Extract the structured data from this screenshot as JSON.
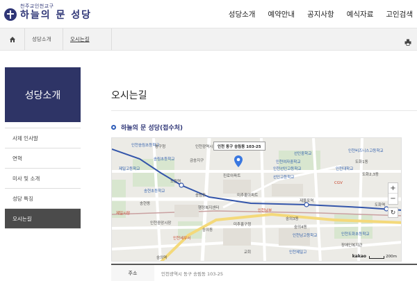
{
  "header": {
    "logo_sub": "천주교인천교구",
    "logo_main": "하늘의 문 성당",
    "nav": [
      "성당소개",
      "예약안내",
      "공지사항",
      "예식자료",
      "고인검색"
    ]
  },
  "breadcrumb": {
    "home_icon": "home-icon",
    "items": [
      "성당소개",
      "오시는길"
    ],
    "print_icon": "printer-icon"
  },
  "sidebar": {
    "title": "성당소개",
    "items": [
      {
        "label": "사제 인사말",
        "active": false
      },
      {
        "label": "연혁",
        "active": false
      },
      {
        "label": "미사 및 소개",
        "active": false
      },
      {
        "label": "성당 특징",
        "active": false
      },
      {
        "label": "오시는길",
        "active": true
      }
    ]
  },
  "main": {
    "title": "오시는길",
    "section_title": "하늘의 문 성당(접수처)",
    "map": {
      "tooltip": "인천 동구 송림동 103-25",
      "zoom_in": "+",
      "zoom_out": "−",
      "reset": "↻",
      "logo": "kakao",
      "scale": "200m",
      "labels": {
        "l1": "인천송림초등학교",
        "l2": "금송지구",
        "l3": "진로아파트",
        "l4": "송림동",
        "l5": "인천여자중학교",
        "l6": "선인고등학교",
        "l7": "도원역",
        "l8": "송현동",
        "l9": "행정복지센터",
        "l10": "미추홀구청",
        "l11": "숭의역",
        "l12": "제물포역",
        "l13": "도화역",
        "l14": "인천대학교",
        "l15": "숭의동",
        "l16": "도화1동",
        "l17": "인천남부",
        "l18": "동구청",
        "l19": "제일시장",
        "l20": "인천광역시",
        "l21": "CGV",
        "l22": "인천비즈니스고등학교",
        "l23": "인천중앙시장",
        "l24": "인천남고등학교",
        "l25": "미추홀아파트",
        "l26": "제일고등학교",
        "l27": "숭의3동",
        "l28": "인천도화초등학교",
        "l29": "송림초등학교",
        "l30": "인천제일고",
        "l31": "송현초등학교",
        "l32": "인천세무서",
        "l33": "도화2,3동",
        "l34": "숭의4동",
        "l35": "선인중학교",
        "l36": "인천선인고등학교",
        "l37": "장애인복지관",
        "l38": "교회"
      }
    },
    "info": {
      "key": "주소",
      "value": "인천광역시 동구 송림동 103-25"
    }
  },
  "colors": {
    "brand": "#2e3466",
    "active_menu": "#4b4b4b",
    "subway_line": "#3355aa",
    "pin": "#3a78e0"
  }
}
